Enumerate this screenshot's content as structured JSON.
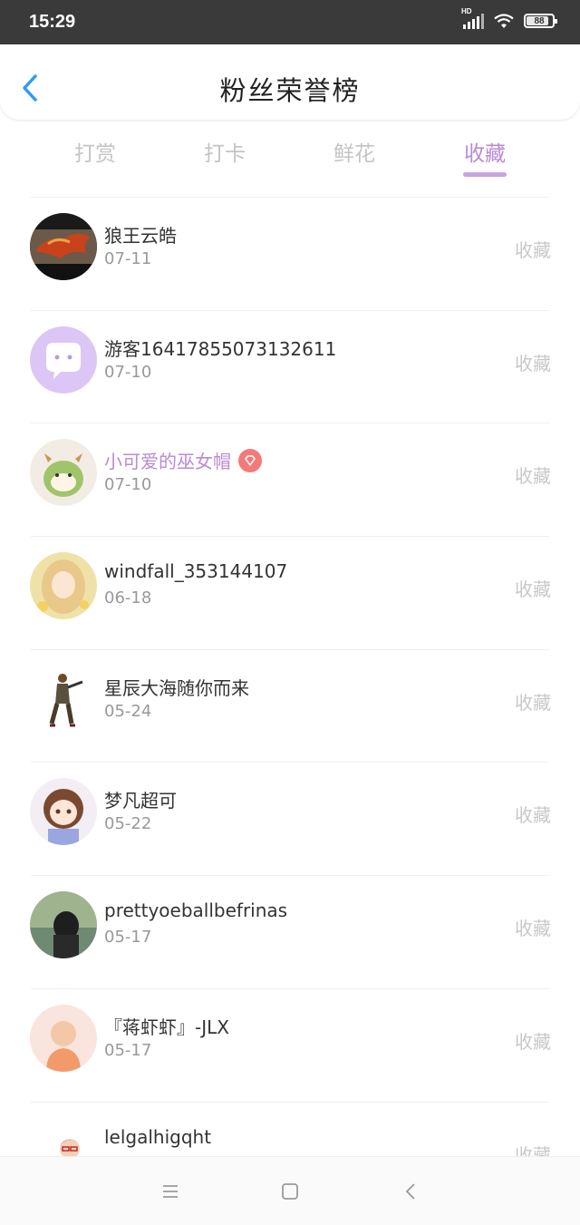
{
  "status_bar": {
    "time": "15:29",
    "battery": "88",
    "network": "HD"
  },
  "header": {
    "title": "粉丝荣誉榜"
  },
  "tabs": [
    {
      "label": "打赏",
      "active": false
    },
    {
      "label": "打卡",
      "active": false
    },
    {
      "label": "鲜花",
      "active": false
    },
    {
      "label": "收藏",
      "active": true
    }
  ],
  "list": [
    {
      "name": "狼王云皓",
      "date": "07-11",
      "tag": "收藏",
      "vip": false,
      "avatar": "dragon-avatar"
    },
    {
      "name": "游客16417855073132611",
      "date": "07-10",
      "tag": "收藏",
      "vip": false,
      "avatar": "default-chat-avatar"
    },
    {
      "name": "小可爱的巫女帽",
      "date": "07-10",
      "tag": "收藏",
      "vip": true,
      "avatar": "green-dino-avatar"
    },
    {
      "name": "windfall_353144107",
      "date": "06-18",
      "tag": "收藏",
      "vip": false,
      "avatar": "anime-girl-avatar"
    },
    {
      "name": "星辰大海随你而来",
      "date": "05-24",
      "tag": "收藏",
      "vip": false,
      "avatar": "soldier-avatar"
    },
    {
      "name": "梦凡超可",
      "date": "05-22",
      "tag": "收藏",
      "vip": false,
      "avatar": "chibi-girl-avatar"
    },
    {
      "name": "prettyoeballbefrinas",
      "date": "05-17",
      "tag": "收藏",
      "vip": false,
      "avatar": "landscape-avatar"
    },
    {
      "name": "『蒋虾虾』-JLX",
      "date": "05-17",
      "tag": "收藏",
      "vip": false,
      "avatar": "kid-avatar"
    },
    {
      "name": "lelgalhigqht",
      "date": "",
      "tag": "收藏",
      "vip": false,
      "avatar": "boy-avatar"
    }
  ],
  "colors": {
    "accent": "#b98ad6",
    "back": "#2a9df4",
    "vip_badge": "#f47a7a"
  },
  "nav": {
    "icons": [
      "menu-icon",
      "home-square-icon",
      "back-chevron-icon"
    ]
  }
}
